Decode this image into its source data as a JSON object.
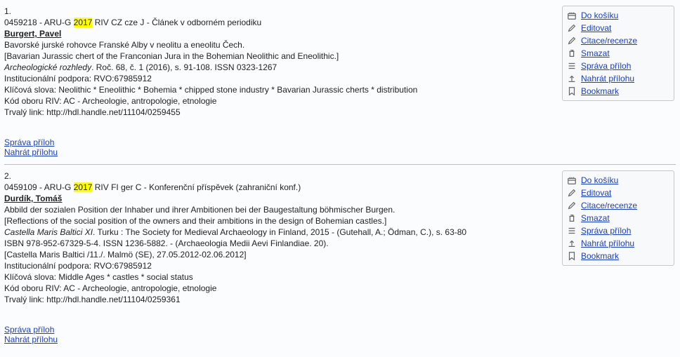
{
  "actions": {
    "basket": "Do košíku",
    "edit": "Editovat",
    "cite": "Citace/recenze",
    "delete": "Smazat",
    "attach_manage": "Správa příloh",
    "attach_upload": "Nahrát přílohu",
    "bookmark": "Bookmark"
  },
  "records": [
    {
      "num": "1.",
      "id_pre": "0459218 - ARU-G ",
      "year": "2017",
      "id_post": " RIV CZ cze J - Článek v odborném periodiku",
      "author": "Burgert, Pavel",
      "title_native": "Bavorské jurské rohovce Franské Alby v neolitu a eneolitu Čech.",
      "title_trans": "[Bavarian Jurassic chert of the Franconian Jura in the Bohemian Neolithic and Eneolithic.]",
      "source_italic": "Archeologické rozhledy",
      "source_rest": ". Roč. 68, č. 1 (2016), s. 91-108. ISSN 0323-1267",
      "inst_support": "Institucionální podpora: RVO:67985912",
      "keywords": "Klíčová slova: Neolithic * Eneolithic * Bohemia * chipped stone industry * Bavarian Jurassic cherts * distribution",
      "riv": "Kód oboru RIV: AC - Archeologie, antropologie, etnologie",
      "permalink_label": "Trvalý link: ",
      "permalink": "http://hdl.handle.net/11104/0259455",
      "bottom_manage": "Správa příloh",
      "bottom_upload": "Nahrát přílohu"
    },
    {
      "num": "2.",
      "id_pre": "0459109 - ARU-G ",
      "year": "2017",
      "id_post": " RIV FI ger C - Konferenční příspěvek (zahraniční konf.)",
      "author": "Durdík, Tomáš",
      "title_native": "Abbild der sozialen Position der Inhaber und ihrer Ambitionen bei der Baugestaltung böhmischer Burgen.",
      "title_trans": "[Reflections of the social position of the owners and their ambitions in the design of Bohemian castles.]",
      "source_italic": "Castella Maris Baltici XI",
      "source_rest": ". Turku : The Society for Medieval Archaeology in Finland, 2015 - (Gutehall, A.; Ödman, C.), s. 63-80",
      "isbn": "ISBN 978-952-67329-5-4. ISSN 1236-5882. - (Archaeologia Medii Aevi Finlandiae. 20).",
      "conf": "[Castella Maris Baltici /11./. Malmö (SE), 27.05.2012-02.06.2012]",
      "inst_support": "Institucionální podpora: RVO:67985912",
      "keywords": "Klíčová slova: Middle Ages * castles * social status",
      "riv": "Kód oboru RIV: AC - Archeologie, antropologie, etnologie",
      "permalink_label": "Trvalý link: ",
      "permalink": "http://hdl.handle.net/11104/0259361",
      "bottom_manage": "Správa příloh",
      "bottom_upload": "Nahrát přílohu"
    }
  ]
}
